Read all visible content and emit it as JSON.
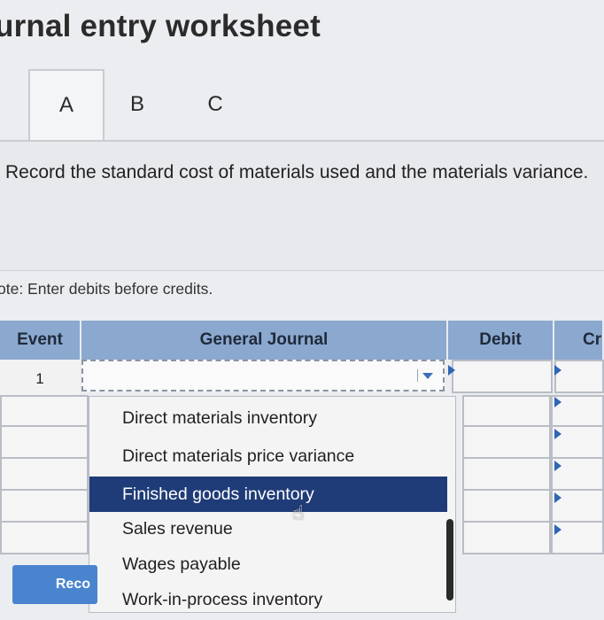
{
  "worksheet": {
    "title": "urnal entry worksheet",
    "tabs": [
      {
        "label": "A",
        "active": true
      },
      {
        "label": "B",
        "active": false
      },
      {
        "label": "C",
        "active": false
      }
    ],
    "instruction": "Record the standard cost of materials used and the materials variance.",
    "note": "ote: Enter debits before credits."
  },
  "table": {
    "headers": {
      "event": "Event",
      "journal": "General Journal",
      "debit": "Debit",
      "credit": "Cr"
    },
    "rows": [
      {
        "event": "1"
      }
    ]
  },
  "dropdown": {
    "options": [
      "Direct materials inventory",
      "Direct materials price variance",
      "Finished goods inventory",
      "Sales revenue",
      "Wages payable",
      "Work-in-process inventory"
    ],
    "highlighted": "Finished goods inventory"
  },
  "button": {
    "record_label": "Reco"
  },
  "colors": {
    "header_bg": "#8ba8cf",
    "highlight": "#1f3c78",
    "accent": "#4a84cf"
  }
}
